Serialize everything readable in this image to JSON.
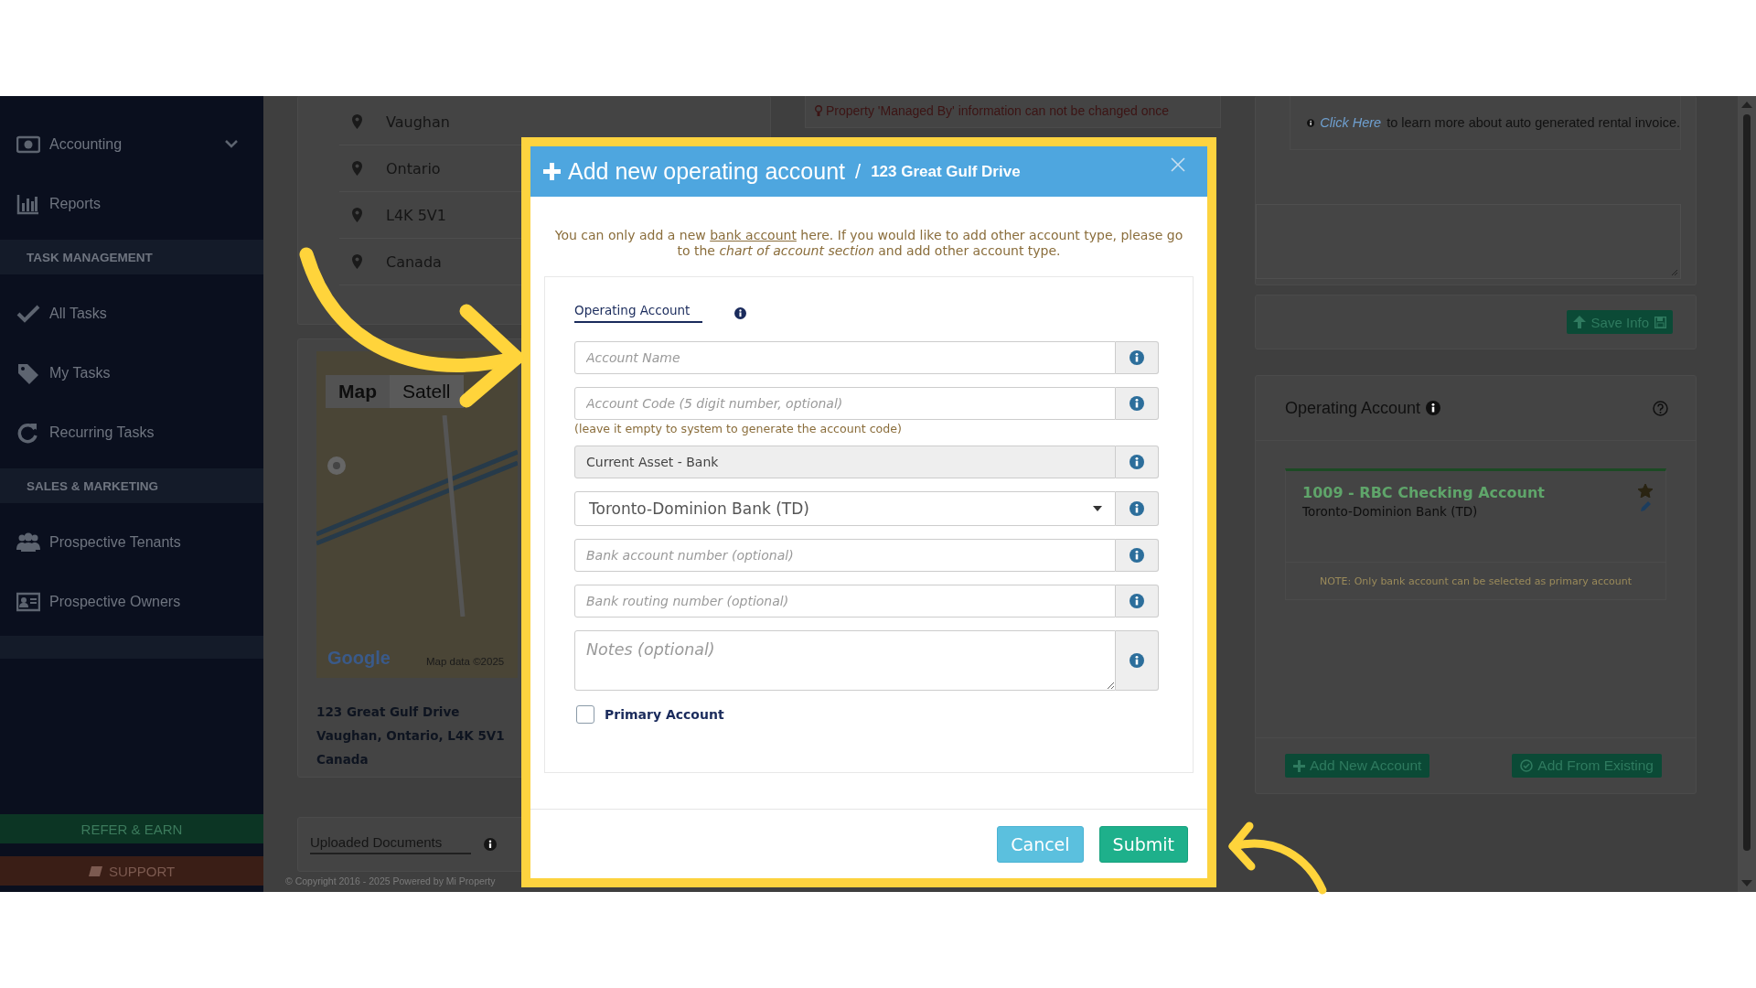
{
  "sidebar": {
    "items": [
      {
        "kind": "link",
        "label": "Accounting",
        "submenu": true
      },
      {
        "kind": "link",
        "label": "Reports",
        "submenu": false
      },
      {
        "kind": "header",
        "label": "TASK MANAGEMENT"
      },
      {
        "kind": "link",
        "label": "All Tasks",
        "submenu": false
      },
      {
        "kind": "link",
        "label": "My Tasks",
        "submenu": false
      },
      {
        "kind": "link",
        "label": "Recurring Tasks",
        "submenu": false
      },
      {
        "kind": "header",
        "label": "SALES & MARKETING"
      },
      {
        "kind": "link",
        "label": "Prospective Tenants",
        "submenu": false
      },
      {
        "kind": "link",
        "label": "Prospective Owners",
        "submenu": false
      }
    ],
    "buttons": [
      {
        "kind": "refer",
        "label": "REFER & EARN"
      },
      {
        "kind": "support",
        "label": "SUPPORT"
      }
    ]
  },
  "property": {
    "address_rows": [
      "Vaughan",
      "Ontario",
      "L4K 5V1",
      "Canada"
    ],
    "map": {
      "tabs": [
        {
          "label": "Map",
          "selected": true
        },
        {
          "label": "Satell",
          "selected": false
        }
      ],
      "logo": "Google",
      "attribution": "Map data ©2025"
    },
    "address_lines": [
      "123 Great Gulf Drive",
      "Vaughan, Ontario, L4K 5V1",
      "Canada"
    ],
    "tabs": [
      {
        "label": "Uploaded Documents",
        "selected": true
      }
    ],
    "copyright": "© Copyright 2016 - 2025 Powered by Mi Property"
  },
  "managed_note": "Property 'Managed By' information can not be changed once",
  "invoice_info": {
    "link": "Click Here",
    "text": "to learn more about auto generated rental invoice."
  },
  "save_button": "Save Info",
  "operating_panel": {
    "title": "Operating Account",
    "accounts": [
      {
        "title": "1009 - RBC Checking Account",
        "bank": "Toronto-Dominion Bank (TD)",
        "primary": true
      }
    ],
    "note": "NOTE: Only bank account can be selected as primary account",
    "buttons": [
      {
        "kind": "add",
        "label": "Add New Account"
      },
      {
        "kind": "existing",
        "label": "Add From Existing"
      }
    ]
  },
  "modal": {
    "title": "Add new operating account",
    "separator": "/",
    "subtitle": "123 Great Gulf Drive",
    "intro": {
      "before": "You can only add a new",
      "link": "bank account",
      "after": "here. If you would like to add other account type, please go to the *chart of account section* and add other account type."
    },
    "section_tab": {
      "label": "Operating Account",
      "selected": true
    },
    "fields": [
      {
        "kind": "input",
        "placeholder": "Account Name"
      },
      {
        "kind": "input",
        "placeholder": "Account Code (5 digit number, optional)",
        "hint": "(leave it empty to system to generate the account code)"
      },
      {
        "kind": "readonly",
        "value": "Current Asset - Bank"
      },
      {
        "kind": "select",
        "value": "Toronto-Dominion Bank (TD)"
      },
      {
        "kind": "input",
        "placeholder": "Bank account number (optional)"
      },
      {
        "kind": "input",
        "placeholder": "Bank routing number (optional)"
      },
      {
        "kind": "textarea",
        "placeholder": "Notes (optional)"
      }
    ],
    "checkbox": {
      "label": "Primary Account",
      "checked": false
    },
    "buttons": [
      {
        "kind": "cancel",
        "label": "Cancel"
      },
      {
        "kind": "submit",
        "label": "Submit"
      }
    ]
  }
}
